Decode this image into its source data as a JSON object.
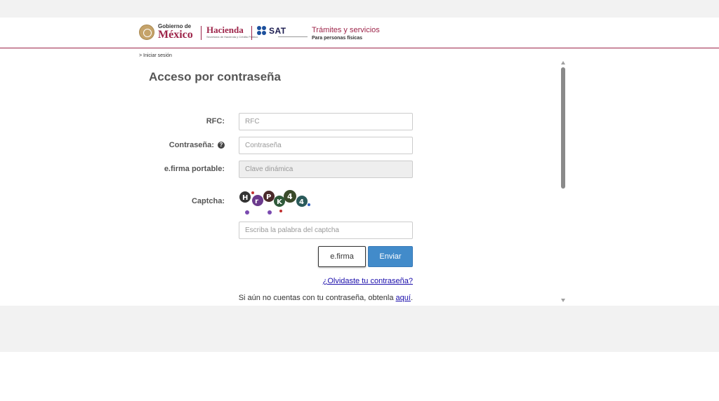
{
  "header": {
    "gob_small": "Gobierno de",
    "gob_big": "México",
    "hacienda": "Hacienda",
    "hacienda_sub": "Secretaría de Hacienda y Crédito Público",
    "sat": "SAT",
    "tramites": "Trámites y servicios",
    "tramites_sub": "Para personas físicas",
    "accent_color": "#9d2449"
  },
  "breadcrumb": "> Iniciar sesión",
  "title": "Acceso por contraseña",
  "form": {
    "rfc_label": "RFC:",
    "rfc_placeholder": "RFC",
    "password_label": "Contraseña:",
    "password_help_icon": "question-circle-icon",
    "password_placeholder": "Contraseña",
    "efirma_label": "e.firma portable:",
    "efirma_placeholder": "Clave dinámica",
    "captcha_label": "Captcha:",
    "captcha_placeholder": "Escriba la palabra del captcha",
    "btn_efirma": "e.firma",
    "btn_enviar": "Enviar",
    "forgot_link": "¿Olvidaste tu contraseña?",
    "no_account_text": "Si aún no cuentas con tu contraseña, obtenla ",
    "no_account_link": "aquí",
    "no_account_end": "."
  },
  "colors": {
    "primary_button": "#428bca",
    "link": "#1a0dab"
  }
}
